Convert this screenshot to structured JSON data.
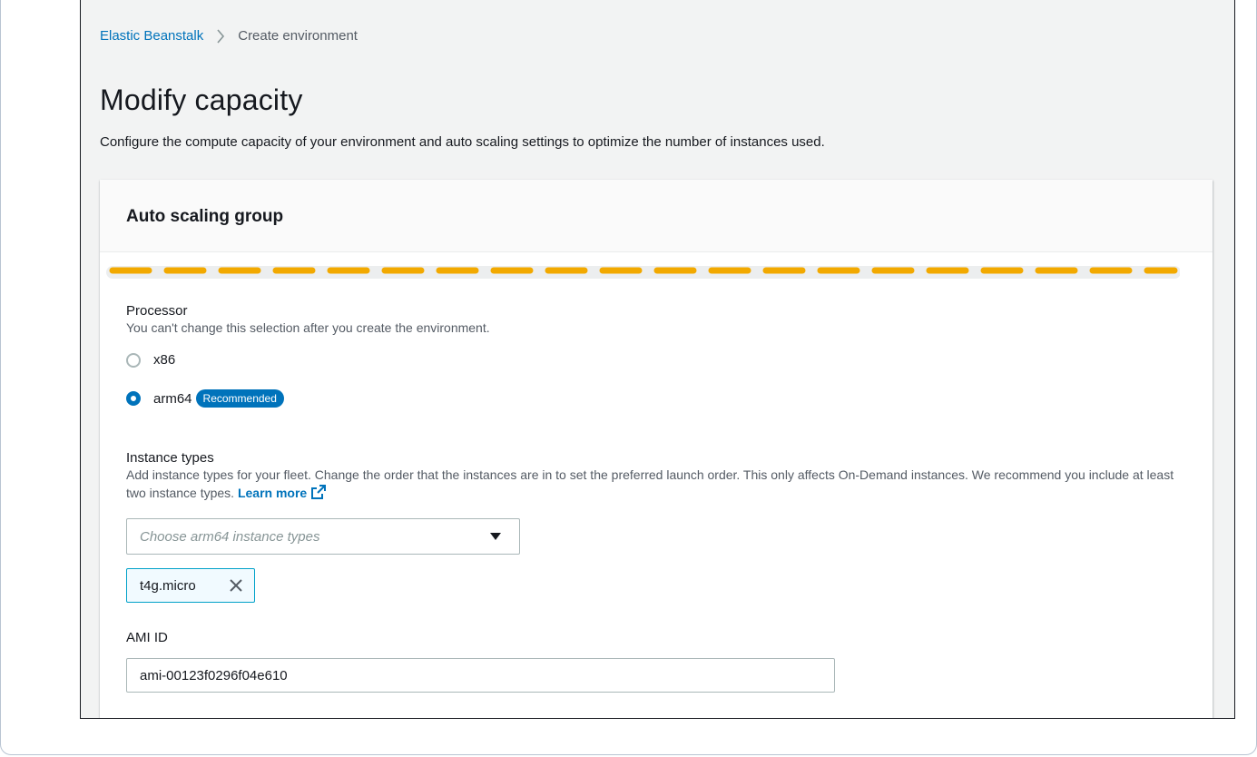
{
  "breadcrumb": {
    "root": "Elastic Beanstalk",
    "current": "Create environment"
  },
  "page": {
    "title": "Modify capacity",
    "description": "Configure the compute capacity of your environment and auto scaling settings to optimize the number of instances used."
  },
  "card": {
    "title": "Auto scaling group"
  },
  "processor": {
    "label": "Processor",
    "description": "You can't change this selection after you create the environment.",
    "options": [
      {
        "label": "x86",
        "selected": false
      },
      {
        "label": "arm64",
        "selected": true,
        "badge": "Recommended"
      }
    ]
  },
  "instance_types": {
    "label": "Instance types",
    "description": "Add instance types for your fleet. Change the order that the instances are in to set the preferred launch order. This only affects On-Demand instances. We recommend you include at least two instance types.",
    "learn_more": "Learn more",
    "placeholder": "Choose arm64 instance types",
    "tokens": [
      "t4g.micro"
    ]
  },
  "ami": {
    "label": "AMI ID",
    "value": "ami-00123f0296f04e610"
  },
  "icons": {
    "breadcrumb_separator": "chevron-right-icon",
    "external_link": "external-link-icon",
    "dropdown": "caret-down-icon",
    "token_remove": "close-icon"
  },
  "colors": {
    "link": "#0073bb",
    "torn_edge_dashes": "#f2a900",
    "page_background": "#f2f3f3"
  }
}
